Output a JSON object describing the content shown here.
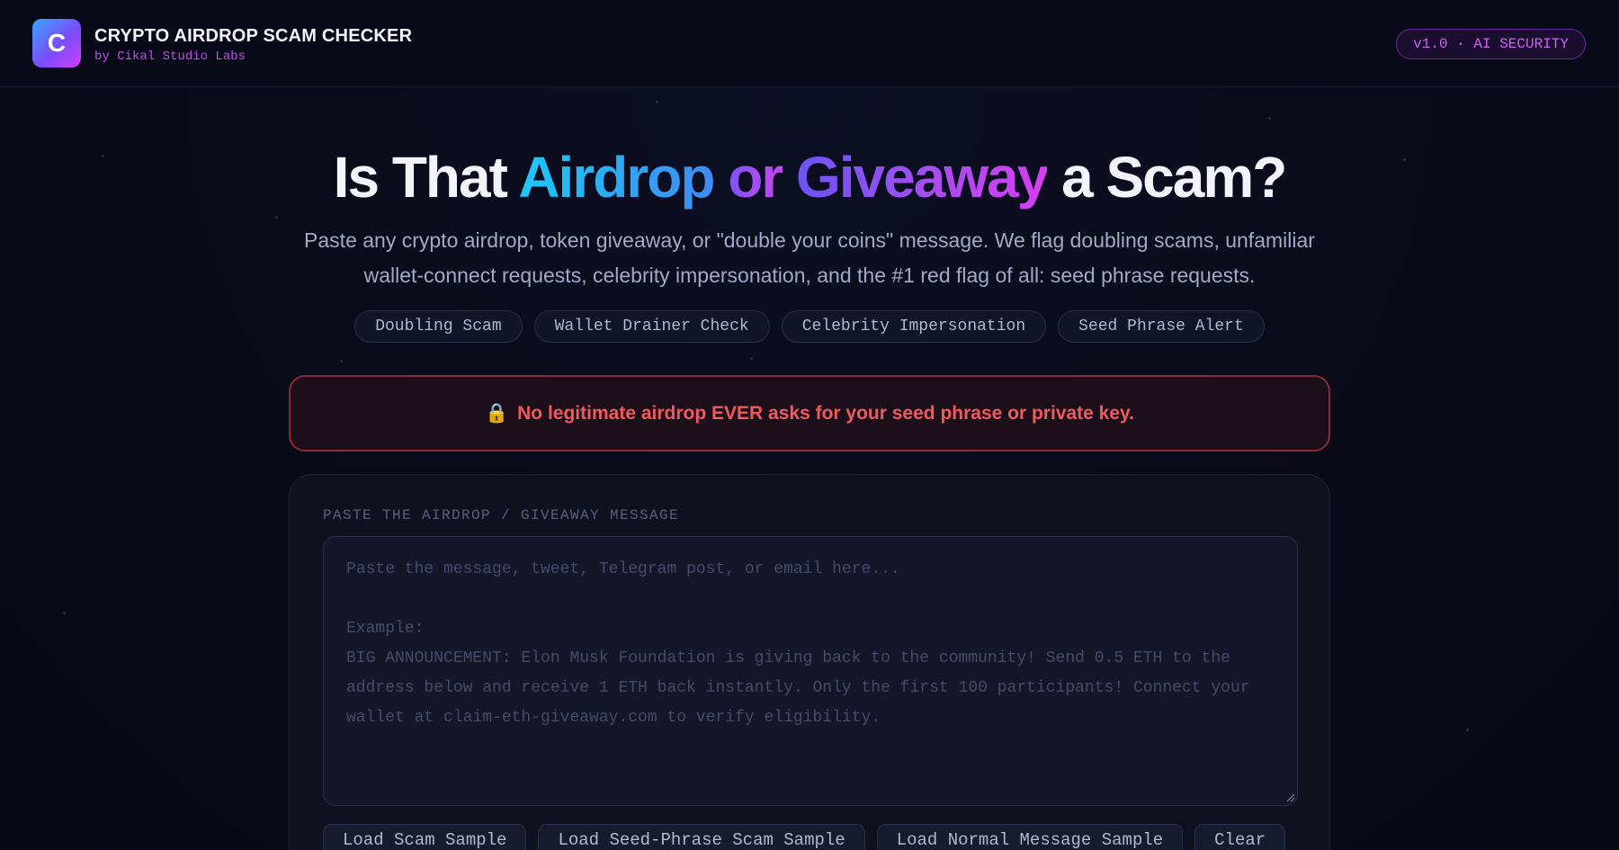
{
  "header": {
    "logo_letter": "C",
    "title": "CRYPTO AIRDROP SCAM CHECKER",
    "subtitle": "by Cikal Studio Labs",
    "version_badge": "v1.0 · AI SECURITY"
  },
  "hero": {
    "title_part1": "Is That ",
    "title_highlight1": "Airdrop",
    "title_connector": " or ",
    "title_highlight2": "Giveaway",
    "title_part2": " a Scam?",
    "description": "Paste any crypto airdrop, token giveaway, or \"double your coins\" message. We flag doubling scams, unfamiliar wallet-connect requests, celebrity impersonation, and the #1 red flag of all: seed phrase requests.",
    "tags": [
      "Doubling Scam",
      "Wallet Drainer Check",
      "Celebrity Impersonation",
      "Seed Phrase Alert"
    ]
  },
  "warning": {
    "icon": "lock-icon",
    "icon_glyph": "🔒",
    "text": "No legitimate airdrop EVER asks for your seed phrase or private key."
  },
  "input_card": {
    "label": "PASTE THE AIRDROP / GIVEAWAY MESSAGE",
    "value": "",
    "placeholder": "Paste the message, tweet, Telegram post, or email here...\n\nExample:\nBIG ANNOUNCEMENT: Elon Musk Foundation is giving back to the community! Send 0.5 ETH to the address below and receive 1 ETH back instantly. Only the first 100 participants! Connect your wallet at claim-eth-giveaway.com to verify eligibility.",
    "buttons": {
      "load_scam": "Load Scam Sample",
      "load_seed": "Load Seed-Phrase Scam Sample",
      "load_normal": "Load Normal Message Sample",
      "clear": "Clear"
    }
  },
  "colors": {
    "background": "#090a17",
    "accent_purple": "#d65cf6",
    "accent_blue": "#1ec8f5",
    "warning_red": "#f05a5e"
  }
}
